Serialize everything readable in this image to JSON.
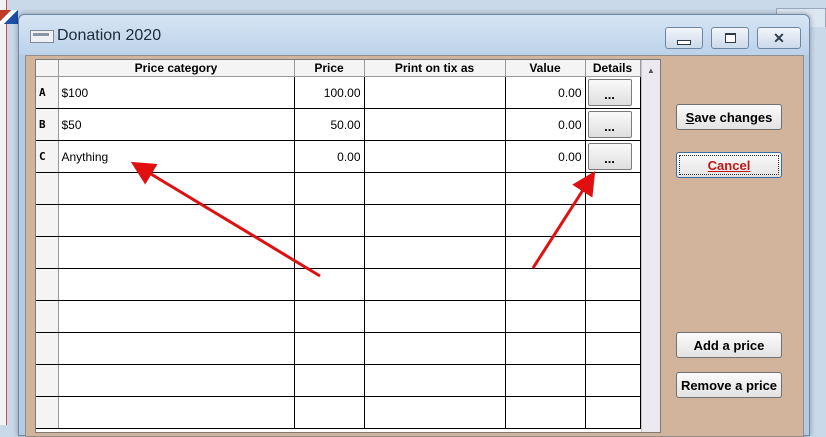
{
  "window": {
    "title": "Donation 2020"
  },
  "grid": {
    "columns": [
      "",
      "Price category",
      "Price",
      "Print on tix as",
      "Value",
      "Details"
    ],
    "rows": [
      {
        "letter": "A",
        "category": "$100",
        "price": "100.00",
        "print_as": "",
        "value": "0.00",
        "details": "..."
      },
      {
        "letter": "B",
        "category": "$50",
        "price": "50.00",
        "print_as": "",
        "value": "0.00",
        "details": "..."
      },
      {
        "letter": "C",
        "category": "Anything",
        "price": "0.00",
        "print_as": "",
        "value": "0.00",
        "details": "..."
      }
    ],
    "empty_rows": 8
  },
  "buttons": {
    "save_pre": "",
    "save_accel": "S",
    "save_post": "ave changes",
    "cancel": "Cancel",
    "add_price": "Add a price",
    "remove_price": "Remove a price"
  },
  "annotations": {
    "arrow_color": "#e01010"
  },
  "icons": {
    "window": "app-window-icon",
    "minimize": "minimize-icon",
    "maximize": "maximize-icon",
    "close": "close-icon",
    "scroll_up": "scroll-up-arrow-icon"
  }
}
